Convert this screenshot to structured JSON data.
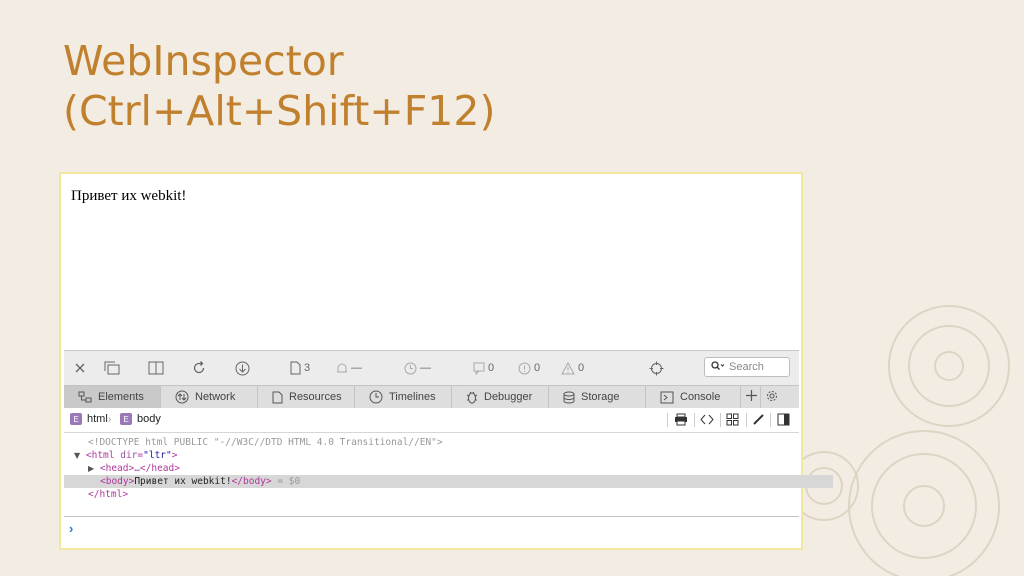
{
  "slide": {
    "title_line1": "WebInspector",
    "title_line2": "(Ctrl+Alt+Shift+F12)"
  },
  "page": {
    "text": "Привет их webkit!"
  },
  "toolbar": {
    "resources_count": "3",
    "warnings_dash": "—",
    "timeline_dash": "—",
    "logs_count": "0",
    "errors_count": "0",
    "issues_count": "0",
    "search_placeholder": "Search",
    "icons": [
      "close-icon",
      "dock-icon",
      "split-icon",
      "reload-icon",
      "download-icon",
      "document-icon",
      "bell-icon",
      "clock-icon",
      "message-icon",
      "error-icon",
      "warning-icon",
      "target-icon",
      "search-icon"
    ]
  },
  "tabs": [
    {
      "label": "Elements",
      "icon": "elements-icon",
      "active": true
    },
    {
      "label": "Network",
      "icon": "network-icon",
      "active": false
    },
    {
      "label": "Resources",
      "icon": "resources-icon",
      "active": false
    },
    {
      "label": "Timelines",
      "icon": "timelines-icon",
      "active": false
    },
    {
      "label": "Debugger",
      "icon": "debugger-icon",
      "active": false
    },
    {
      "label": "Storage",
      "icon": "storage-icon",
      "active": false
    },
    {
      "label": "Console",
      "icon": "console-icon",
      "active": false
    }
  ],
  "breadcrumb": {
    "badge": "E",
    "items": [
      "html",
      "body"
    ]
  },
  "dom": {
    "doctype": "<!DOCTYPE html PUBLIC \"-//W3C//DTD HTML 4.0 Transitional//EN\">",
    "html_open_tag": "<html",
    "html_attr_name": "dir",
    "html_attr_value": "\"ltr\"",
    "head_line": "<head>…</head>",
    "body_open": "<body>",
    "body_text": "Привет их webkit!",
    "body_close": "</body>",
    "body_ref": "= $0",
    "html_close": "</html>"
  },
  "console": {
    "prompt": "›"
  },
  "colors": {
    "title": "#c0802e",
    "background": "#f3ece2",
    "tag": "#b0379b",
    "badge": "#9b79b8",
    "prompt": "#2d74d3"
  }
}
